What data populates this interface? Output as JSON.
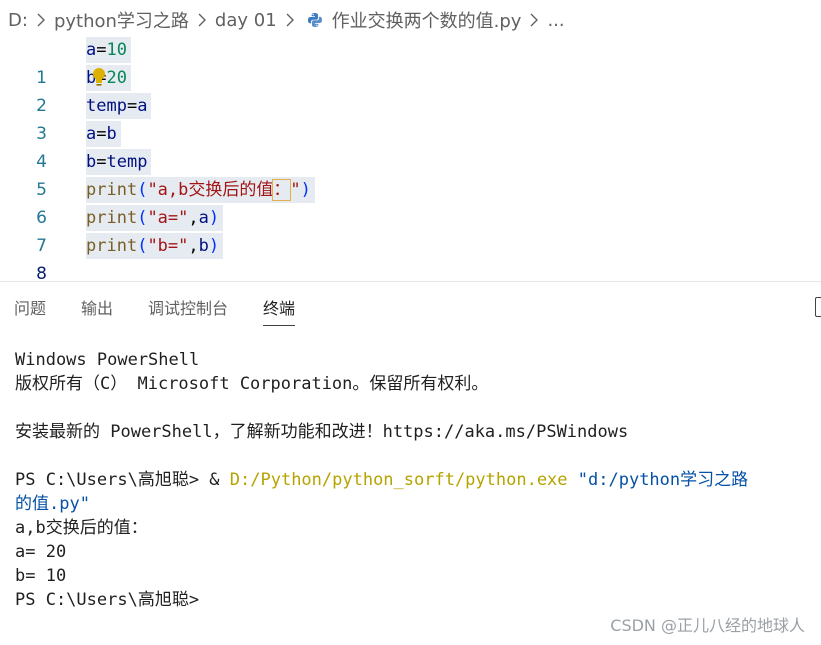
{
  "breadcrumb": {
    "drive": "D:",
    "folder1": "python学习之路",
    "folder2": "day 01",
    "file": "作业交换两个数的值.py",
    "ellipsis": "..."
  },
  "editor": {
    "lines": [
      {
        "no": "1",
        "parts": [
          "a",
          "=",
          "10"
        ]
      },
      {
        "no": "2",
        "parts": [
          "b",
          "=",
          "20"
        ]
      },
      {
        "no": "3",
        "parts": [
          "temp",
          "=",
          "a"
        ]
      },
      {
        "no": "4",
        "parts": [
          "a",
          "=",
          "b"
        ]
      },
      {
        "no": "5",
        "parts": [
          "b",
          "=",
          "temp"
        ]
      },
      {
        "no": "6",
        "parts": [
          "print",
          "(",
          "\"a,b交换后的值",
          "：",
          "\"",
          ")"
        ]
      },
      {
        "no": "7",
        "parts": [
          "print",
          "(",
          "\"a=\"",
          ",",
          "a",
          ")"
        ]
      },
      {
        "no": "8",
        "parts": [
          "print",
          "(",
          "\"b=\"",
          ",",
          "b",
          ")"
        ]
      }
    ]
  },
  "panel": {
    "tabs": [
      "问题",
      "输出",
      "调试控制台",
      "终端"
    ],
    "active_tab": "终端"
  },
  "terminal": {
    "l1": "Windows PowerShell",
    "l2": "版权所有（C） Microsoft Corporation。保留所有权利。",
    "l3": "安装最新的 PowerShell，了解新功能和改进！https://aka.ms/PSWindows",
    "prompt": "PS C:\\Users\\高旭聪> ",
    "amp": "& ",
    "exe_path": "D:/Python/python_sorft/python.exe",
    "script_arg_part1": " \"d:/python学习之路",
    "script_arg_part2": "的值.py\"",
    "out1": "a,b交换后的值：",
    "out2": "a= 20",
    "out3": "b= 10",
    "prompt_end": "PS C:\\Users\\高旭聪>"
  },
  "watermark": "CSDN @正儿八经的地球人",
  "colors": {
    "line_number": "#237893",
    "selection": "#e5ebf1",
    "variable": "#001080",
    "number": "#098658",
    "function": "#795e26",
    "string": "#a31515",
    "paren": "#0431fa",
    "exe_path": "#b5a300",
    "string_arg": "#0451a5"
  },
  "icons": {
    "separator": "chevron-right-icon",
    "file": "python-file-icon",
    "lightbulb": "lightbulb-icon",
    "panel_action": "maximize-panel-icon"
  }
}
